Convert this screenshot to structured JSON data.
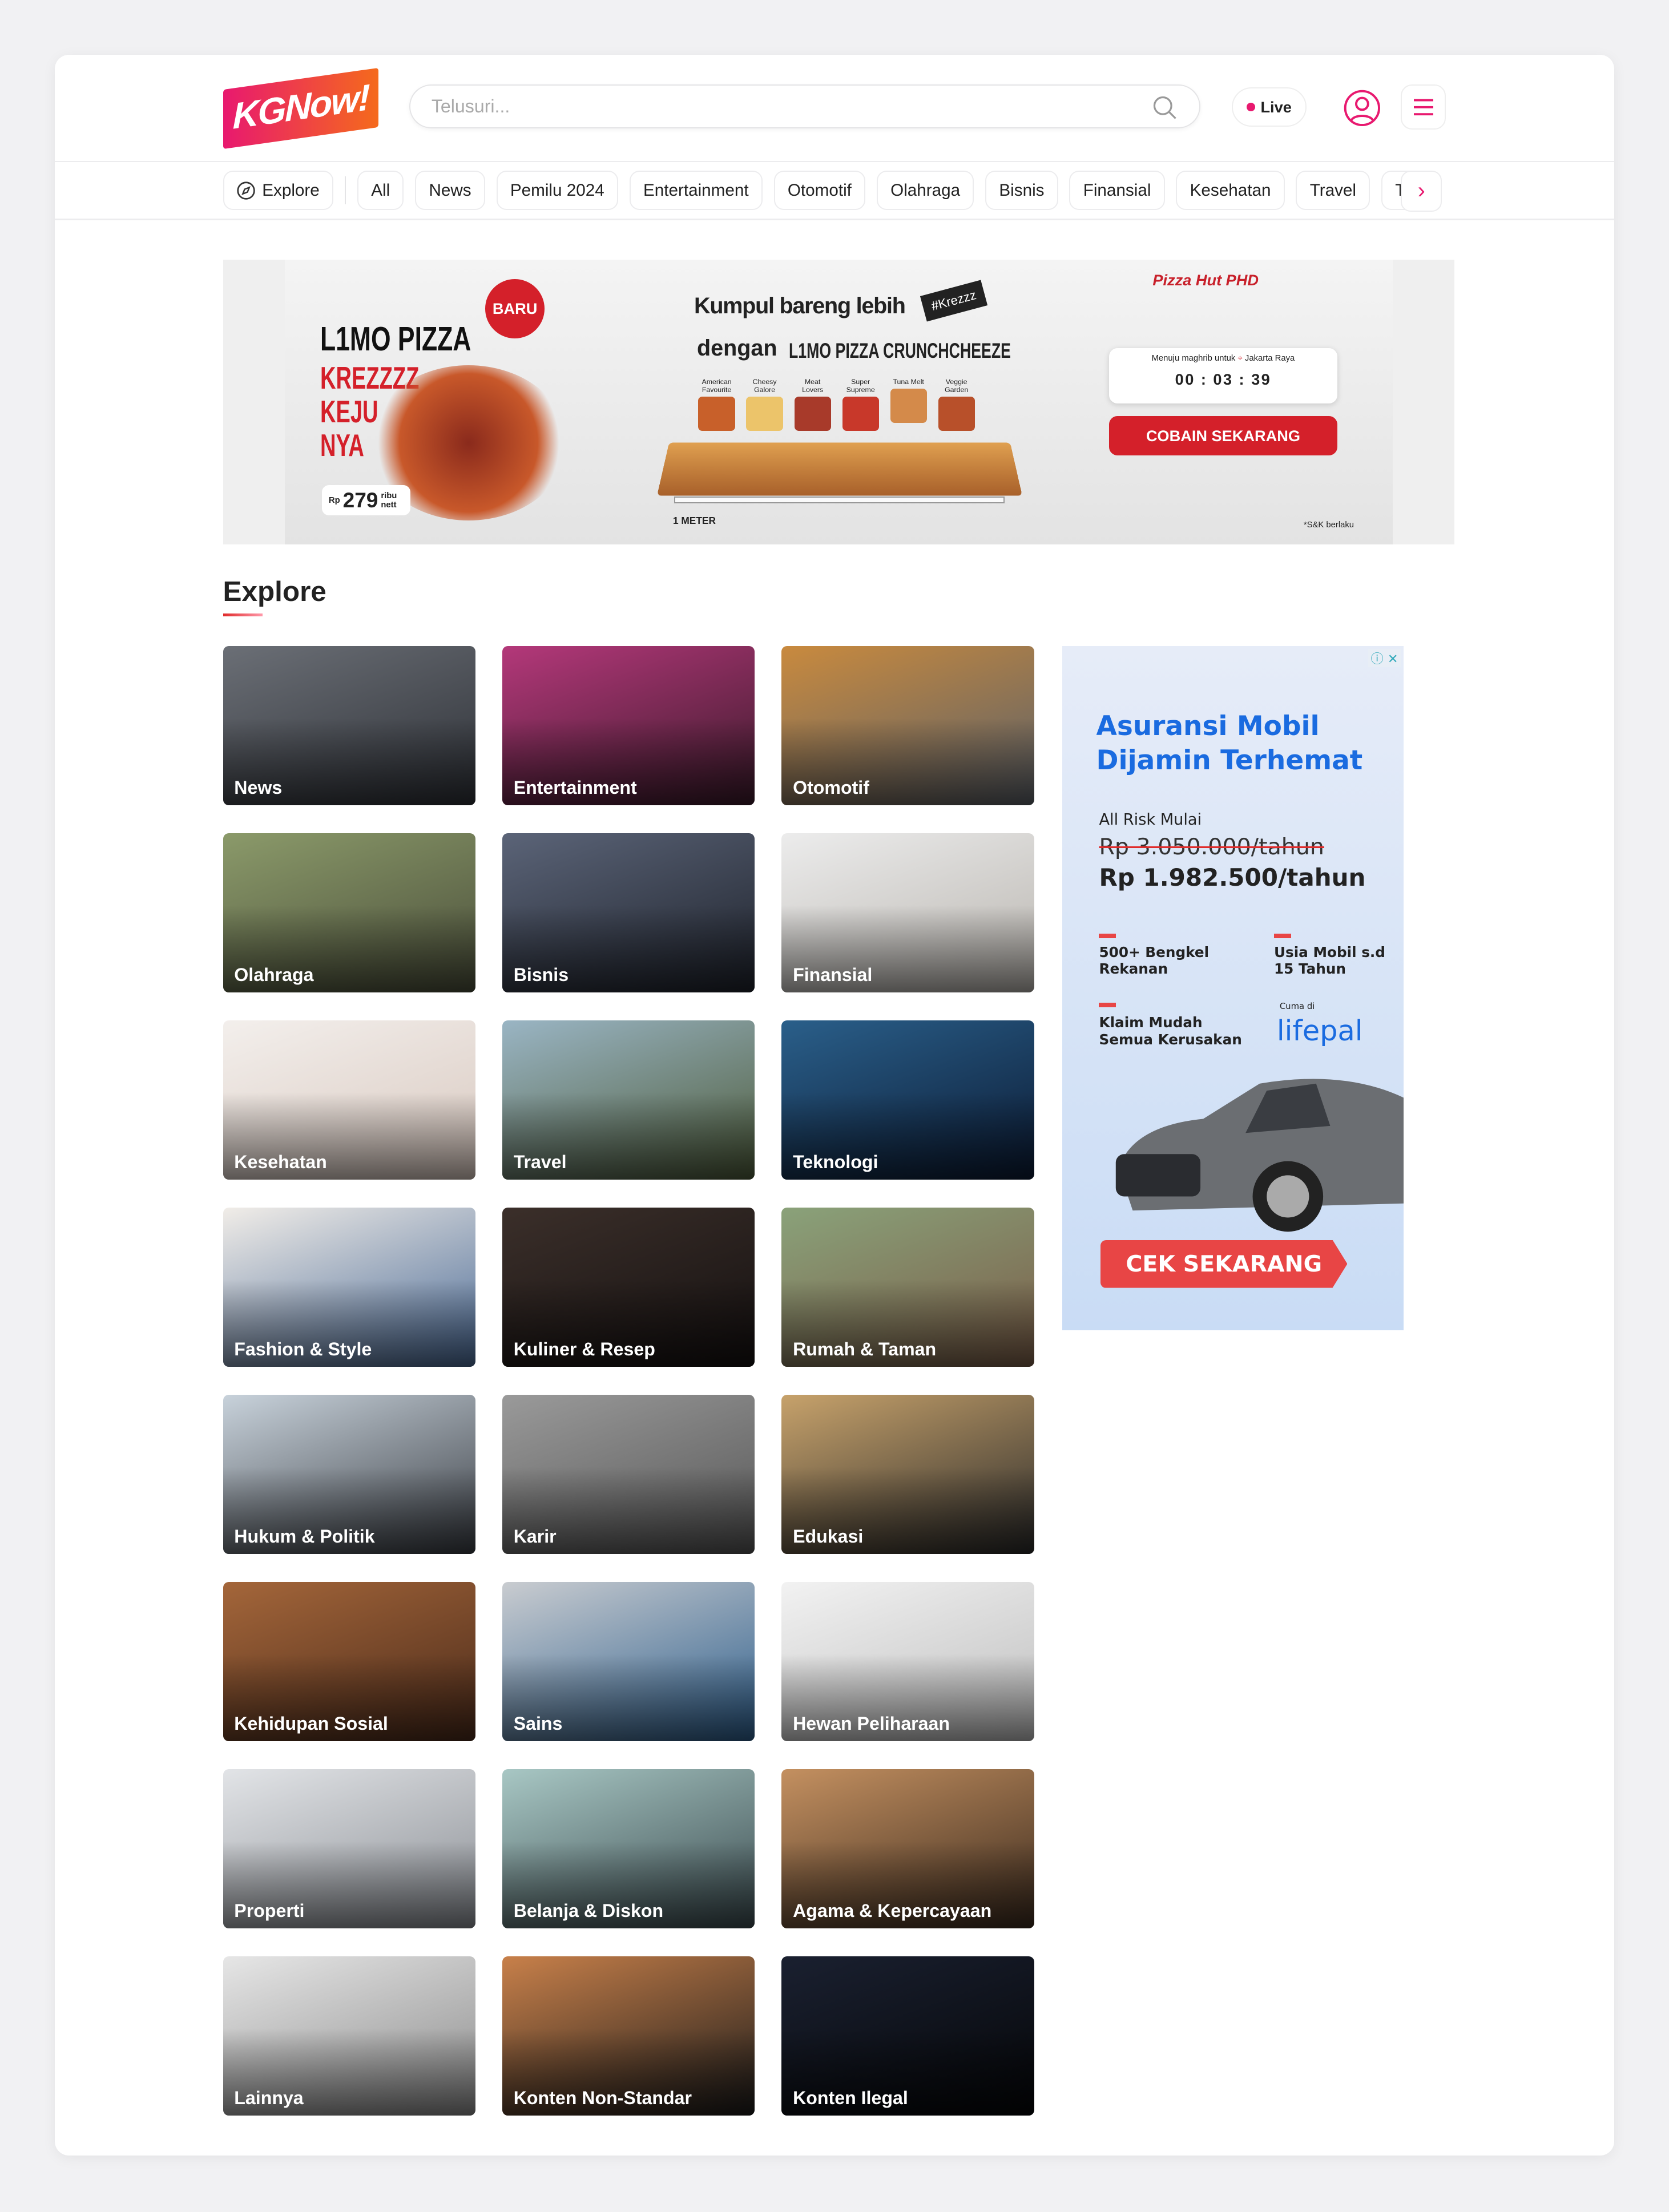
{
  "header": {
    "logo_text": "KGNow!",
    "search_placeholder": "Telusuri...",
    "live_label": "Live",
    "accent_color": "#e8196f"
  },
  "categories": {
    "explore_label": "Explore",
    "items": [
      "All",
      "News",
      "Pemilu 2024",
      "Entertainment",
      "Otomotif",
      "Olahraga",
      "Bisnis",
      "Finansial",
      "Kesehatan",
      "Travel",
      "Te"
    ]
  },
  "banner": {
    "headline_1": "Kumpul bareng lebih",
    "tag": "#Krezzz",
    "headline_2": "dengan",
    "product": "L1MO PIZZA CRUNCHCHEEZE",
    "left_title": "L1MO PIZZA",
    "left_sub": "KREZZZZ KEJU NYA",
    "badge": "BARU",
    "price": "279",
    "price_prefix": "Rp",
    "price_unit": "ribu nett",
    "flavors": [
      "American Favourite",
      "Cheesy Galore",
      "Meat Lovers",
      "Super Supreme",
      "Tuna Melt",
      "Veggie Garden"
    ],
    "measure": "1 METER",
    "brands": "Pizza Hut  PHD",
    "countdown_label": "Menuju maghrib untuk",
    "countdown_location": "Jakarta Raya",
    "countdown": "00 : 03 : 39",
    "cta": "COBAIN SEKARANG",
    "terms": "*S&K berlaku"
  },
  "explore": {
    "title": "Explore",
    "tiles": [
      {
        "label": "News",
        "colors": [
          "#6b6f76",
          "#2d3036"
        ]
      },
      {
        "label": "Entertainment",
        "colors": [
          "#b4387a",
          "#3a1a2a"
        ]
      },
      {
        "label": "Otomotif",
        "colors": [
          "#c98a3e",
          "#5a6068"
        ]
      },
      {
        "label": "Olahraga",
        "colors": [
          "#8b9a6a",
          "#4a4e3a"
        ]
      },
      {
        "label": "Bisnis",
        "colors": [
          "#5b6478",
          "#1e222b"
        ]
      },
      {
        "label": "Finansial",
        "colors": [
          "#ececec",
          "#b8b4ae"
        ]
      },
      {
        "label": "Kesehatan",
        "colors": [
          "#f3efec",
          "#d8c8bf"
        ]
      },
      {
        "label": "Travel",
        "colors": [
          "#9ab5c4",
          "#4d5b3a"
        ]
      },
      {
        "label": "Teknologi",
        "colors": [
          "#2a5f8a",
          "#0b1a33"
        ]
      },
      {
        "label": "Fashion & Style",
        "colors": [
          "#f1ede8",
          "#4a6a96"
        ]
      },
      {
        "label": "Kuliner & Resep",
        "colors": [
          "#3b2f2a",
          "#141010"
        ]
      },
      {
        "label": "Rumah & Taman",
        "colors": [
          "#8aa27a",
          "#7a5d48"
        ]
      },
      {
        "label": "Hukum & Politik",
        "colors": [
          "#c8d2db",
          "#3a3e44"
        ]
      },
      {
        "label": "Karir",
        "colors": [
          "#9a9a9a",
          "#555"
        ]
      },
      {
        "label": "Edukasi",
        "colors": [
          "#c7a26b",
          "#2a2a2a"
        ]
      },
      {
        "label": "Kehidupan Sosial",
        "colors": [
          "#a4663a",
          "#4a2a1a"
        ]
      },
      {
        "label": "Sains",
        "colors": [
          "#c9ccd0",
          "#2d5e8c"
        ]
      },
      {
        "label": "Hewan Peliharaan",
        "colors": [
          "#f2f2f2",
          "#bdbdbd"
        ]
      },
      {
        "label": "Properti",
        "colors": [
          "#e2e4e7",
          "#8a8e94"
        ]
      },
      {
        "label": "Belanja & Diskon",
        "colors": [
          "#a8c7c4",
          "#3a4a4e"
        ]
      },
      {
        "label": "Agama & Kepercayaan",
        "colors": [
          "#c49060",
          "#3a2a1e"
        ]
      },
      {
        "label": "Lainnya",
        "colors": [
          "#e6e6e6",
          "#8a8a8a"
        ]
      },
      {
        "label": "Konten Non-Standar",
        "colors": [
          "#c8804a",
          "#1a1a1a"
        ]
      },
      {
        "label": "Konten Ilegal",
        "colors": [
          "#1a2030",
          "#050608"
        ]
      }
    ]
  },
  "side_ad": {
    "title_1": "Asuransi Mobil",
    "title_2": "Dijamin Terhemat",
    "lead": "All Risk Mulai",
    "old_price": "Rp 3.050.000/tahun",
    "new_price": "Rp 1.982.500/tahun",
    "feature_1": "500+ Bengkel Rekanan",
    "feature_2": "Usia Mobil s.d 15 Tahun",
    "feature_3": "Klaim Mudah Semua Kerusakan",
    "only_at": "Cuma di",
    "brand": "lifepal",
    "cta": "CEK SEKARANG"
  }
}
